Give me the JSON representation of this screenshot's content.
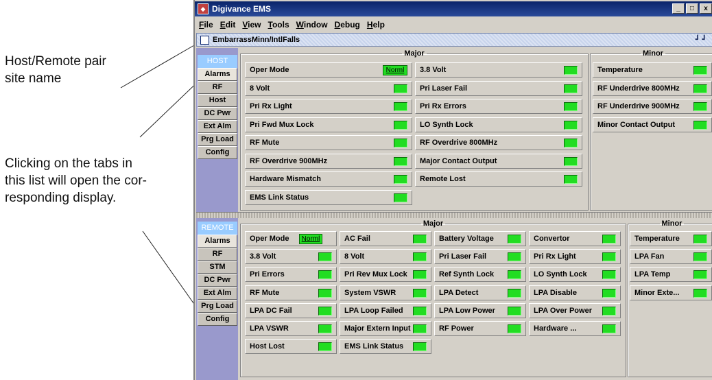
{
  "annotations": {
    "host_remote": [
      "Host/Remote pair",
      "site name"
    ],
    "tabs_note": [
      "Clicking on the tabs in",
      "this list will open the cor-",
      "responding display."
    ]
  },
  "window": {
    "title": "Digivance EMS",
    "controls": [
      "_",
      "□",
      "x"
    ]
  },
  "menu": [
    "File",
    "Edit",
    "View",
    "Tools",
    "Window",
    "Debug",
    "Help"
  ],
  "inner_window": {
    "title": "EmbarrassMinn/IntlFalls",
    "controls": "┛┛"
  },
  "host": {
    "tabs": [
      "HOST",
      "Alarms",
      "RF",
      "Host",
      "DC Pwr",
      "Ext Alm",
      "Prg Load",
      "Config"
    ],
    "major_label": "Major",
    "minor_label": "Minor",
    "major_col1": [
      "Oper Mode",
      "8 Volt",
      "Pri Rx Light",
      "Pri Fwd Mux Lock",
      "RF Mute",
      "RF Overdrive 900MHz",
      "Hardware Mismatch",
      "EMS Link Status"
    ],
    "major_col2": [
      "3.8 Volt",
      "Pri Laser Fail",
      "Pri Rx Errors",
      "LO Synth Lock",
      "RF Overdrive 800MHz",
      "Major Contact Output",
      "Remote Lost"
    ],
    "minor": [
      "Temperature",
      "RF Underdrive 800MHz",
      "RF Underdrive 900MHz",
      "Minor Contact Output"
    ],
    "oper_mode_value": "Norml"
  },
  "remote": {
    "tabs": [
      "REMOTE",
      "Alarms",
      "RF",
      "STM",
      "DC Pwr",
      "Ext Alm",
      "Prg Load",
      "Config"
    ],
    "major_label": "Major",
    "minor_label": "Minor",
    "major_col1": [
      "Oper Mode",
      "3.8 Volt",
      "Pri Errors",
      "RF Mute",
      "LPA DC Fail",
      "LPA VSWR",
      "Host Lost"
    ],
    "major_col2": [
      "AC Fail",
      "8 Volt",
      "Pri Rev Mux Lock",
      "System VSWR",
      "LPA Loop Failed",
      "Major Extern Input",
      "EMS Link Status"
    ],
    "major_col3": [
      "Battery Voltage",
      "Pri Laser Fail",
      "Ref Synth Lock",
      "LPA Detect",
      "LPA Low Power",
      "RF Power"
    ],
    "major_col4": [
      "Convertor",
      "Pri Rx Light",
      "LO Synth Lock",
      "LPA Disable",
      "LPA Over Power",
      "Hardware ..."
    ],
    "minor": [
      "Temperature",
      "LPA Fan",
      "LPA Temp",
      "Minor Exte..."
    ],
    "oper_mode_value": "Norml"
  },
  "colors": {
    "led_ok": "#22dd22",
    "title_bar": "#0a246a",
    "sidebar": "#9999cc",
    "tab_head": "#99ccff"
  }
}
